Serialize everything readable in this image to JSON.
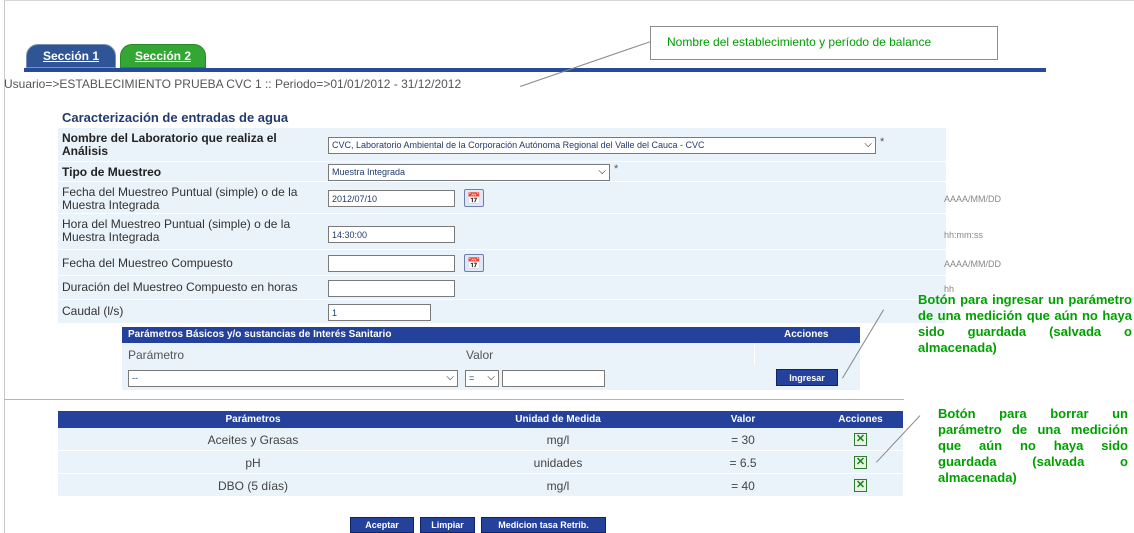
{
  "tabs": [
    {
      "label": "Sección 1"
    },
    {
      "label": "Sección 2"
    }
  ],
  "user_line": "Usuario=>ESTABLECIMIENTO PRUEBA CVC 1 :: Periodo=>01/01/2012 - 31/12/2012",
  "callouts": {
    "top": "Nombre del establecimiento y período de balance",
    "add": "Botón para ingresar un parámetro de una medición que aún no haya sido guardada (salvada o almacenada)",
    "delete": "Botón para borrar un parámetro de una medición que aún no haya sido guardada (salvada o almacenada)"
  },
  "form": {
    "title": "Caracterización de entradas de agua",
    "lab_label": "Nombre del Laboratorio que realiza el Análisis",
    "lab_value": "CVC, Laboratorio Ambiental de la Corporación Autónoma Regional del Valle del Cauca - CVC",
    "tipo_label": "Tipo de Muestreo",
    "tipo_value": "Muestra Integrada",
    "fecha_label": "Fecha del Muestreo Puntual (simple) o de la Muestra Integrada",
    "fecha_value": "2012/07/10",
    "fecha_fmt": "AAAA/MM/DD",
    "hora_label": "Hora del Muestreo Puntual (simple) o de la Muestra Integrada",
    "hora_value": "14:30:00",
    "hora_fmt": "hh:mm:ss",
    "fecha_comp_label": "Fecha del Muestreo Compuesto",
    "fecha_comp_value": "",
    "fecha_comp_fmt": "AAAA/MM/DD",
    "duracion_label": "Duración del Muestreo Compuesto en horas",
    "duracion_value": "",
    "duracion_fmt": "hh",
    "caudal_label": "Caudal (l/s)",
    "caudal_value": "1",
    "required_mark": "*"
  },
  "params": {
    "header": "Parámetros Básicos y/o sustancias de Interés Sanitario",
    "acciones": "Acciones",
    "col_param": "Parámetro",
    "col_valor": "Valor",
    "param_select": "--",
    "op_select": "=",
    "value_input": "",
    "ingresar_label": "Ingresar"
  },
  "results": {
    "headers": [
      "Parámetros",
      "Unidad de Medida",
      "Valor",
      "Acciones"
    ],
    "rows": [
      {
        "param": "Aceites y Grasas",
        "unit": "mg/l",
        "value": "= 30"
      },
      {
        "param": "pH",
        "unit": "unidades",
        "value": "= 6.5"
      },
      {
        "param": "DBO (5 días)",
        "unit": "mg/l",
        "value": "= 40"
      }
    ]
  },
  "buttons": {
    "aceptar": "Aceptar",
    "limpiar": "Limpiar",
    "medicion": "Medicion tasa Retrib."
  },
  "icons": {
    "calendar": "calendar-icon",
    "delete": "delete-x-icon",
    "dropdown": "chevron-down-icon"
  },
  "colors": {
    "primary": "#24419b",
    "tab_green": "#33a633",
    "row_bg": "#eaf2fa",
    "callout_text": "#00a000"
  }
}
